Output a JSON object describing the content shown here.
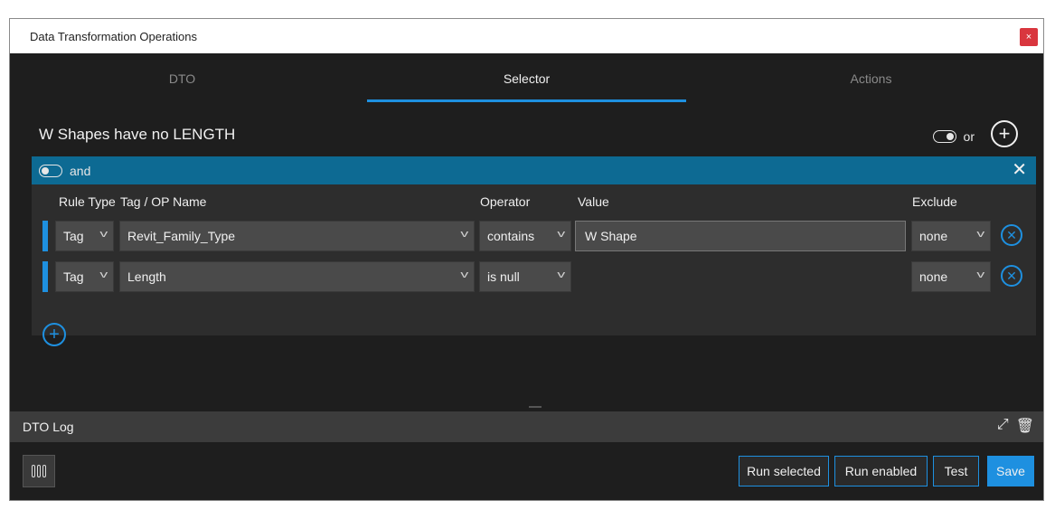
{
  "window": {
    "title": "Data Transformation Operations",
    "close_glyph": "×"
  },
  "tabs": [
    {
      "label": "DTO",
      "active": false
    },
    {
      "label": "Selector",
      "active": true
    },
    {
      "label": "Actions",
      "active": false
    }
  ],
  "selector": {
    "title": "W Shapes have no LENGTH",
    "or_label": "or",
    "add_group_glyph": "+",
    "group": {
      "logic_label": "and",
      "close_glyph": "✕",
      "columns": {
        "rule_type": "Rule Type",
        "tag_name": "Tag / OP Name",
        "operator": "Operator",
        "value": "Value",
        "exclude": "Exclude"
      },
      "rows": [
        {
          "rule_type": "Tag",
          "tag_name": "Revit_Family_Type",
          "operator": "contains",
          "value": "W Shape",
          "exclude": "none"
        },
        {
          "rule_type": "Tag",
          "tag_name": "Length",
          "operator": "is null",
          "value": "",
          "exclude": "none"
        }
      ],
      "remove_glyph": "✕",
      "add_rule_glyph": "+"
    }
  },
  "log": {
    "label": "DTO Log",
    "expand_glyph": "⤢",
    "delete_glyph": "🗑"
  },
  "footer": {
    "run_selected": "Run selected",
    "run_enabled": "Run enabled",
    "test": "Test",
    "save": "Save"
  },
  "colors": {
    "accent": "#1e90e0",
    "group_header": "#0d6a93",
    "background": "#1e1e1e"
  }
}
